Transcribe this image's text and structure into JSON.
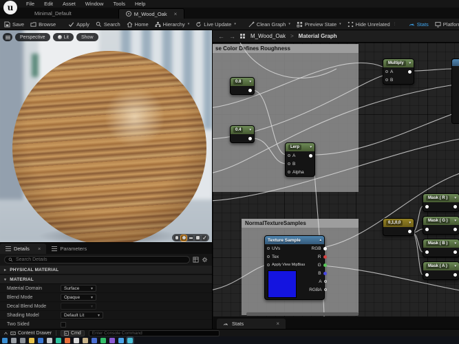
{
  "window": {
    "menu_items": [
      "File",
      "Edit",
      "Asset",
      "Window",
      "Tools",
      "Help"
    ],
    "tabs": [
      {
        "label": "Minimal_Default"
      },
      {
        "label": "M_Wood_Oak"
      }
    ]
  },
  "toolbar": {
    "save": "Save",
    "browse": "Browse",
    "apply": "Apply",
    "search": "Search",
    "home": "Home",
    "hierarchy": "Hierarchy",
    "live_update": "Live Update",
    "clean_graph": "Clean Graph",
    "preview_state": "Preview State",
    "hide_unrelated": "Hide Unrelated",
    "stats": "Stats",
    "platform_stats": "Platform Stats"
  },
  "viewport": {
    "perspective": "Perspective",
    "lit": "Lit",
    "show": "Show",
    "preview_shapes": [
      "cylinder",
      "sphere",
      "plane",
      "cube",
      "custom-mesh"
    ],
    "selected_shape": "sphere"
  },
  "graph": {
    "breadcrumb": {
      "asset": "M_Wood_Oak",
      "separator": ">",
      "page": "Material Graph"
    },
    "comments": [
      {
        "label": "se Color Defines Roughness"
      },
      {
        "label": "NormalTextureSamples"
      }
    ],
    "nodes": {
      "const_a": {
        "title": "0.8"
      },
      "const_b": {
        "title": "0.4"
      },
      "lerp": {
        "title": "Lerp",
        "inputs": [
          "A",
          "B",
          "Alpha"
        ]
      },
      "multiply": {
        "title": "Multiply",
        "inputs": [
          "A",
          "B"
        ]
      },
      "texture_sample": {
        "title": "Texture Sample",
        "inputs": [
          "UVs",
          "Tex",
          "Apply View MipBias"
        ],
        "outputs": [
          "RGB",
          "R",
          "G",
          "B",
          "A",
          "RGBA"
        ]
      },
      "const4": {
        "title": "0,1,0,0"
      },
      "masks": [
        {
          "title": "Mask ( R )"
        },
        {
          "title": "Mask ( G )"
        },
        {
          "title": "Mask ( B )"
        },
        {
          "title": "Mask ( A )"
        }
      ]
    },
    "stats_tab_label": "Stats"
  },
  "details": {
    "tabs": [
      {
        "label": "Details"
      },
      {
        "label": "Parameters"
      }
    ],
    "search_placeholder": "Search Details",
    "sections": [
      {
        "label": "PHYSICAL MATERIAL"
      },
      {
        "label": "MATERIAL"
      }
    ],
    "properties": [
      {
        "label": "Material Domain",
        "value": "Surface",
        "control": "dropdown"
      },
      {
        "label": "Blend Mode",
        "value": "Opaque",
        "control": "dropdown"
      },
      {
        "label": "Decal Blend Mode",
        "value": "",
        "control": "dropdown-disabled"
      },
      {
        "label": "Shading Model",
        "value": "Default Lit",
        "control": "dropdown"
      },
      {
        "label": "Two Sided",
        "value": "unchecked",
        "control": "checkbox"
      }
    ]
  },
  "statusbar": {
    "content_drawer": "Content Drawer",
    "cmd": "Cmd",
    "console_placeholder": "Enter Console Command"
  },
  "taskbar": {
    "icons": [
      {
        "name": "start",
        "color": "#3a8fd4"
      },
      {
        "name": "search",
        "color": "#9aa0a6"
      },
      {
        "name": "task-view",
        "color": "#8a9096"
      },
      {
        "name": "file-explorer",
        "color": "#e8c34a"
      },
      {
        "name": "app-blue",
        "color": "#3a78d4"
      },
      {
        "name": "app-gray",
        "color": "#c6c9cc"
      },
      {
        "name": "app-teal",
        "color": "#2ec4a0"
      },
      {
        "name": "app-orange",
        "color": "#e8703a"
      },
      {
        "name": "app-light",
        "color": "#d8d8d8"
      },
      {
        "name": "app-tan",
        "color": "#c9b48a"
      },
      {
        "name": "app-blue2",
        "color": "#4a6fd4"
      },
      {
        "name": "app-green",
        "color": "#34c06a"
      },
      {
        "name": "app-purple",
        "color": "#8a5ad4"
      },
      {
        "name": "app-blue3",
        "color": "#4aa3e8"
      },
      {
        "name": "app-active-ue",
        "color": "#49c0d8",
        "active": true
      }
    ]
  },
  "colors": {
    "toolbar_active_blue": "#3fa7f2",
    "node_header_green": "#5f7d4f",
    "node_header_blue": "#4a7ba6",
    "node_header_olive": "#8f7d26",
    "pin_red": "#d84040",
    "pin_green": "#58c858",
    "pin_blue": "#4a4ae0",
    "selection_orange": "#e8962e",
    "texture_preview_blue": "#1414e0"
  }
}
